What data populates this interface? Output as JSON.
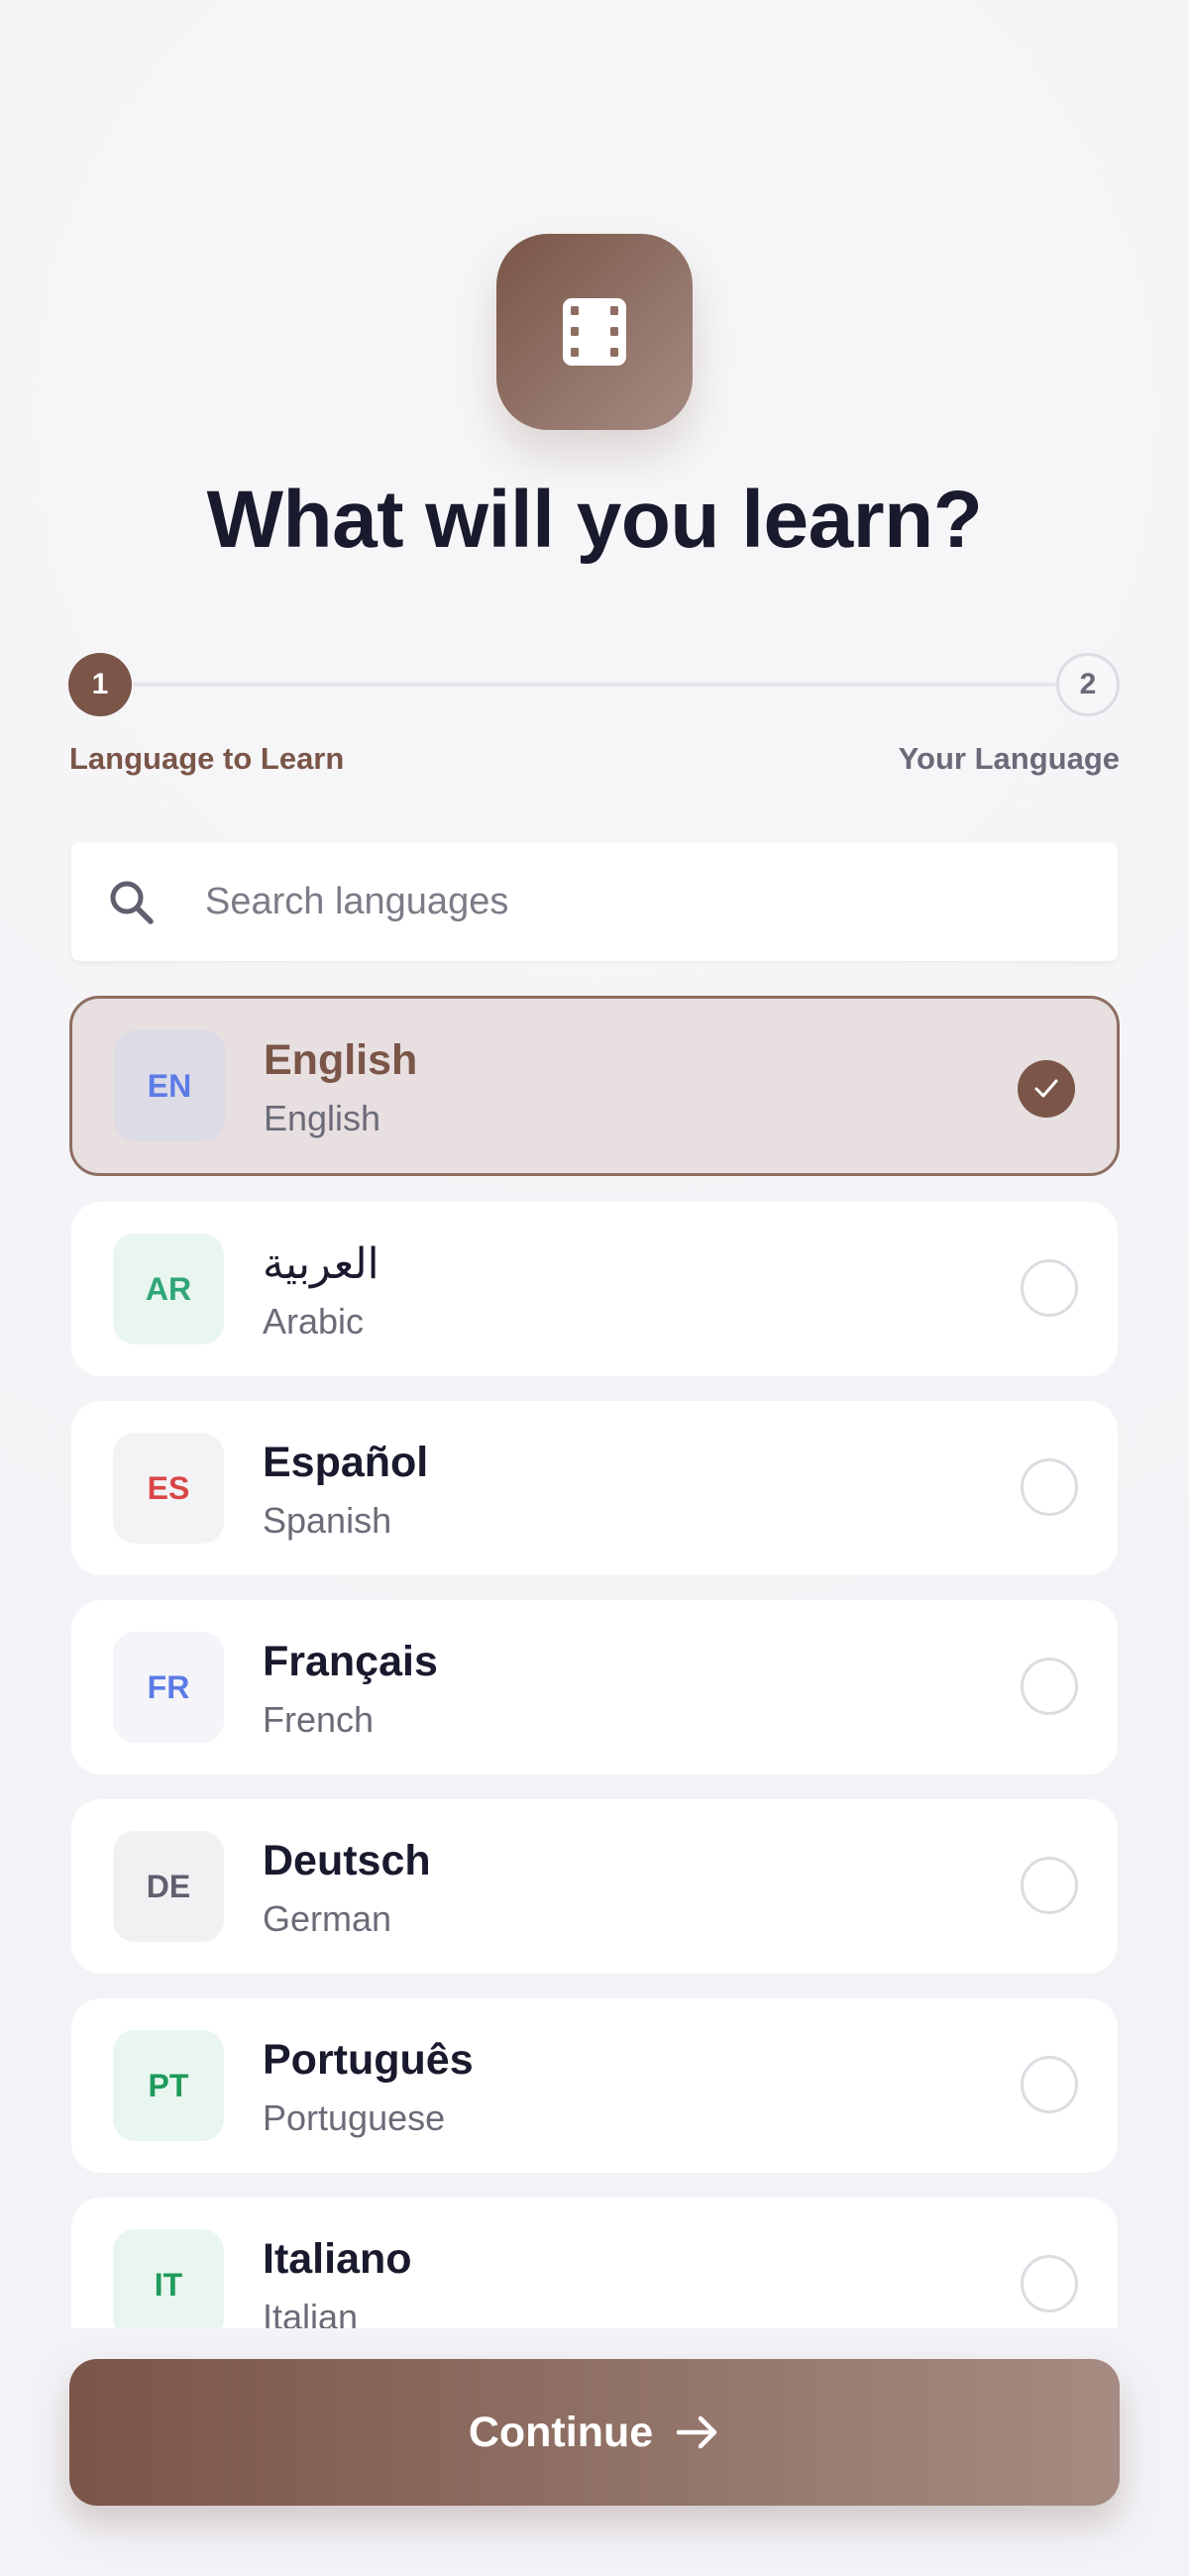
{
  "header": {
    "app_icon": "film-icon",
    "title": "What will you learn?"
  },
  "stepper": {
    "steps": [
      {
        "number": "1",
        "label": "Language to Learn",
        "active": true
      },
      {
        "number": "2",
        "label": "Your Language",
        "active": false
      }
    ]
  },
  "search": {
    "placeholder": "Search languages",
    "value": "",
    "icon": "search-icon"
  },
  "languages": [
    {
      "code": "EN",
      "native": "English",
      "english": "English",
      "selected": true,
      "code_color": "#5b7be6",
      "badge_bg": "#dcdbe6"
    },
    {
      "code": "AR",
      "native": "العربية",
      "english": "Arabic",
      "selected": false,
      "code_color": "#2fa677",
      "badge_bg": "#e8f6ef"
    },
    {
      "code": "ES",
      "native": "Español",
      "english": "Spanish",
      "selected": false,
      "code_color": "#d94646",
      "badge_bg": "#f3f3f6"
    },
    {
      "code": "FR",
      "native": "Français",
      "english": "French",
      "selected": false,
      "code_color": "#5b7be6",
      "badge_bg": "#f4f4f9"
    },
    {
      "code": "DE",
      "native": "Deutsch",
      "english": "German",
      "selected": false,
      "code_color": "#5f5f6e",
      "badge_bg": "#f1f1f4"
    },
    {
      "code": "PT",
      "native": "Português",
      "english": "Portuguese",
      "selected": false,
      "code_color": "#1f9a5d",
      "badge_bg": "#e8f6ef"
    },
    {
      "code": "IT",
      "native": "Italiano",
      "english": "Italian",
      "selected": false,
      "code_color": "#1f9a5d",
      "badge_bg": "#e8f6ef"
    }
  ],
  "footer": {
    "continue_label": "Continue",
    "continue_icon": "arrow-right-icon"
  },
  "colors": {
    "accent": "#7a5548",
    "accent_light": "#a58b82",
    "selected_bg": "#e7dfe0",
    "text_dark": "#1a1a2e",
    "text_muted": "#6b6b78"
  }
}
